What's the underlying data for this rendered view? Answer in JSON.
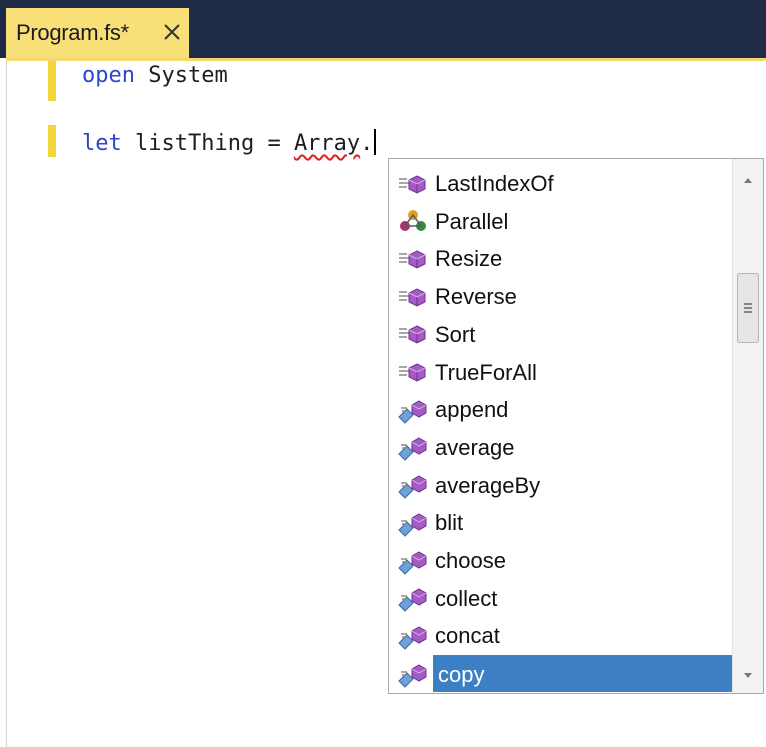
{
  "tab": {
    "title": "Program.fs*"
  },
  "code": {
    "line1_kw": "open",
    "line1_rest": " System",
    "line2_kw": "let",
    "line2_mid": " listThing = ",
    "line2_err": "Array",
    "line2_end": "."
  },
  "completion": {
    "items": [
      {
        "label": "LastIndexOf",
        "icon": "method-icon"
      },
      {
        "label": "Parallel",
        "icon": "namespace-icon"
      },
      {
        "label": "Resize",
        "icon": "method-icon"
      },
      {
        "label": "Reverse",
        "icon": "method-icon"
      },
      {
        "label": "Sort",
        "icon": "method-icon"
      },
      {
        "label": "TrueForAll",
        "icon": "method-icon"
      },
      {
        "label": "append",
        "icon": "extension-method-icon"
      },
      {
        "label": "average",
        "icon": "extension-method-icon"
      },
      {
        "label": "averageBy",
        "icon": "extension-method-icon"
      },
      {
        "label": "blit",
        "icon": "extension-method-icon"
      },
      {
        "label": "choose",
        "icon": "extension-method-icon"
      },
      {
        "label": "collect",
        "icon": "extension-method-icon"
      },
      {
        "label": "concat",
        "icon": "extension-method-icon"
      },
      {
        "label": "copy",
        "icon": "extension-method-icon"
      }
    ],
    "selected": "copy"
  },
  "colors": {
    "tabbar": "#1f2a44",
    "tab_active": "#f9df77",
    "keyword": "#2a48c8",
    "selection": "#3c7fc4"
  }
}
